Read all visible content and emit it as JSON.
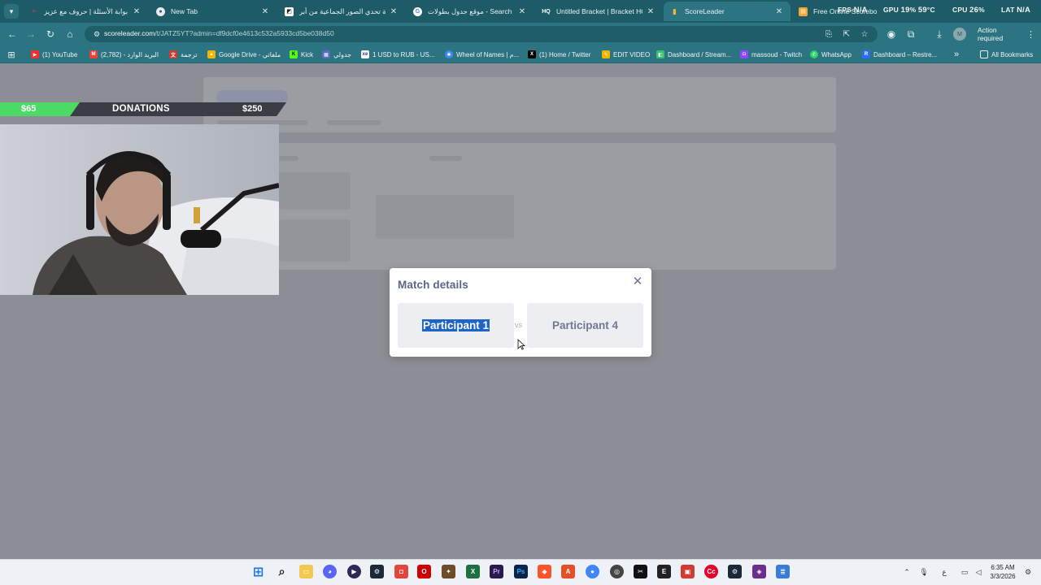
{
  "tabs": [
    {
      "label": "بوابة الأسئلة | حروف مع عزيز",
      "icon": "red-logo-icon",
      "color": "#d8345f"
    },
    {
      "label": "New Tab",
      "icon": "chrome-icon",
      "color": "#e8eaed"
    },
    {
      "label": "لعبة تحدي الصور الجماعية من أبر",
      "icon": "page-icon",
      "color": "#ffffff"
    },
    {
      "label": "موقع جدول بطولات - Search ‏عاي",
      "icon": "google-icon",
      "color": "#ffffff"
    },
    {
      "label": "Untitled Bracket | Bracket HQ",
      "icon": "hq-icon",
      "color": "#ffffff"
    },
    {
      "label": "ScoreLeader",
      "icon": "bars-icon",
      "color": "#f2b632"
    },
    {
      "label": "Free Online Scoreboard - Keep",
      "icon": "board-icon",
      "color": "#f7a531"
    }
  ],
  "hud": {
    "fps_label": "FPS",
    "fps": "N/A",
    "gpu_label": "GPU",
    "gpu": "19",
    "gpu_unit": "%",
    "gpu_temp": "59",
    "gpu_temp_unit": "°C",
    "cpu_label": "CPU",
    "cpu": "26",
    "cpu_unit": "%",
    "lat_label": "LAT",
    "lat": "N/A"
  },
  "toolbar": {
    "url_host": "scoreleader.com",
    "url_path": "/t/JATZ5YT?admin=df9dcf0e4613c532a5933cd5be038d50",
    "action_required": "Action required"
  },
  "bookmarks": [
    {
      "label": "(1) YouTube",
      "icon": "youtube-icon",
      "color": "#ff2a2a"
    },
    {
      "label": "البريد الوارد - (2,782)",
      "icon": "gmail-icon",
      "color": "#ea4335"
    },
    {
      "label": "ترجمة",
      "icon": "translate-icon",
      "color": "#cc3c2d"
    },
    {
      "label": "Google Drive - ملفاتي",
      "icon": "drive-icon",
      "color": "#f4b400"
    },
    {
      "label": "Kick",
      "icon": "kick-icon",
      "color": "#53fc18"
    },
    {
      "label": "جدولي",
      "icon": "table-icon",
      "color": "#5c6bc0"
    },
    {
      "label": "1 USD to RUB - US...",
      "icon": "xe-icon",
      "color": "#ffffff"
    },
    {
      "label": "Wheel of Names | م...",
      "icon": "wheel-icon",
      "color": "#3f88f5"
    },
    {
      "label": "(1) Home / Twitter",
      "icon": "x-icon",
      "color": "#000000"
    },
    {
      "label": "EDIT VIDEO",
      "icon": "edit-icon",
      "color": "#f5b400"
    },
    {
      "label": "Dashboard / Stream...",
      "icon": "dashboard-icon",
      "color": "#35c46d"
    },
    {
      "label": "massoud - Twitch",
      "icon": "twitch-icon",
      "color": "#9146ff"
    },
    {
      "label": "WhatsApp",
      "icon": "whatsapp-icon",
      "color": "#25d366"
    },
    {
      "label": "Dashboard – Restre...",
      "icon": "restream-icon",
      "color": "#2d6bff"
    }
  ],
  "all_bookmarks": "All Bookmarks",
  "overlay": {
    "left_amount": "$65",
    "title": "DONATIONS",
    "right_amount": "$250",
    "accent": "#4cd964"
  },
  "modal": {
    "title": "Match details",
    "participant_a": "Participant 1",
    "vs": "vs",
    "participant_b": "Participant 4"
  },
  "clock": {
    "time": "6:35 AM",
    "date": "3/3/2026"
  },
  "tray": {
    "lang": "ع"
  }
}
